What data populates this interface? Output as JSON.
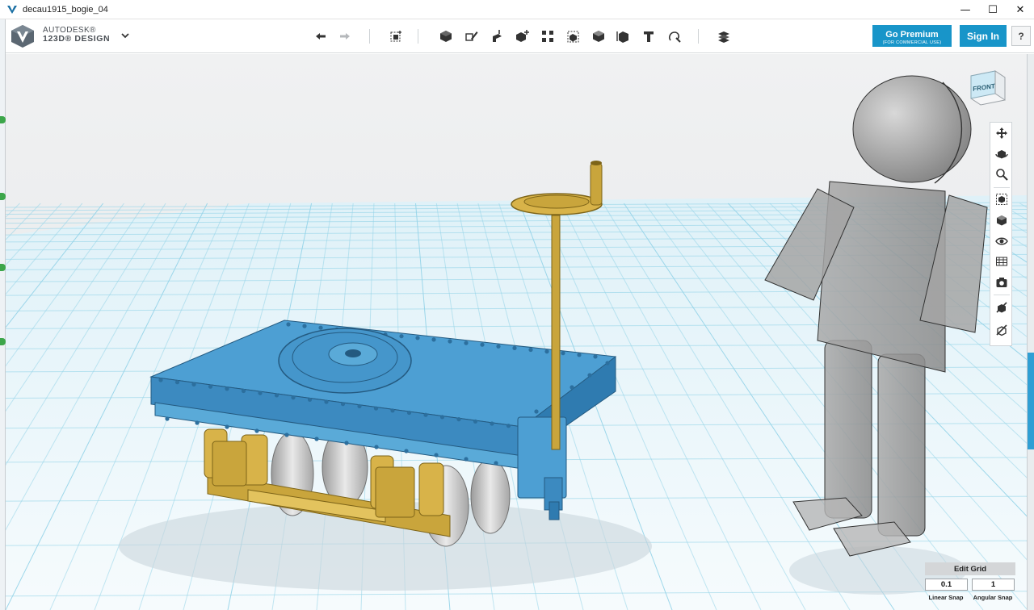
{
  "window": {
    "title": "decau1915_bogie_04",
    "app_icon": "autodesk-v-icon",
    "controls": [
      "minimize-icon",
      "maximize-icon",
      "close-icon"
    ],
    "minimize_glyph": "—",
    "maximize_glyph": "☐",
    "close_glyph": "✕"
  },
  "brand": {
    "line1": "AUTODESK®",
    "line2": "123D® DESIGN",
    "menu_icon": "chevron-down-icon"
  },
  "toolbar": {
    "history": [
      "undo-icon",
      "redo-icon"
    ],
    "transform": [
      "transform-icon"
    ],
    "tools": [
      "primitives-icon",
      "sketch-icon",
      "construct-icon",
      "modify-icon",
      "pattern-icon",
      "grouping-icon",
      "combine-icon",
      "measure-icon",
      "text-icon",
      "snap-icon"
    ],
    "materials": [
      "material-icon"
    ]
  },
  "account": {
    "premium_label": "Go Premium",
    "premium_sublabel": "(FOR COMMERCIAL USE)",
    "signin_label": "Sign In",
    "help_label": "?"
  },
  "viewcube": {
    "face_label": "FRONT"
  },
  "nav": {
    "icons": [
      "pan-icon",
      "orbit-icon",
      "zoom-icon",
      "fit-icon",
      "perspective-icon",
      "visibility-icon",
      "material-view-icon",
      "screenshot-icon",
      "hide-icon",
      "show-icon"
    ]
  },
  "grid": {
    "edit_label": "Edit Grid",
    "linear_snap_value": "0.1",
    "angular_snap_value": "1",
    "linear_snap_label": "Linear Snap",
    "angular_snap_label": "Angular Snap"
  },
  "colors": {
    "accent": "#1895c9",
    "model_blue": "#4d9fd3",
    "model_gold": "#c9a53c",
    "figure_grey": "#9a9a9a",
    "grid_line": "#8fd2e8",
    "background": "#e9eaec"
  }
}
